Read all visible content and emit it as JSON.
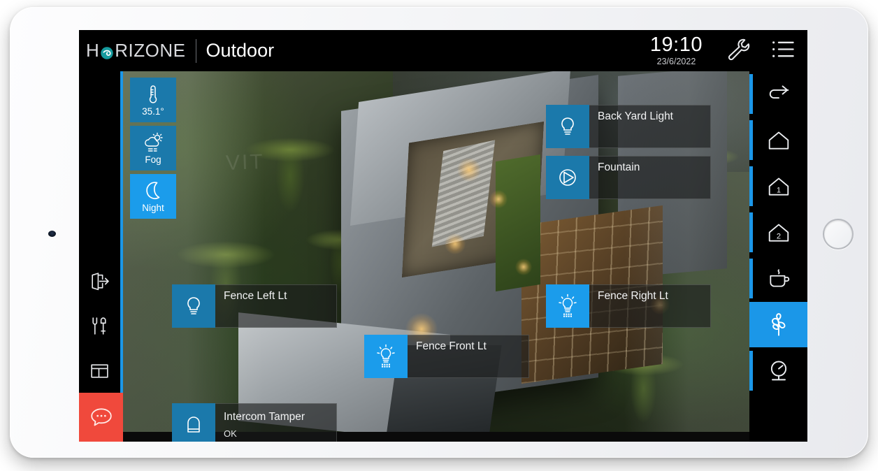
{
  "header": {
    "brand": "HORIZONE",
    "brand_mark_icon": "horizone-swirl-icon",
    "page_title": "Outdoor",
    "time": "19:10",
    "date": "23/6/2022",
    "settings_icon": "wrench-icon",
    "menu_icon": "list-menu-icon"
  },
  "colors": {
    "accent_blue": "#1b9ceb",
    "tile_blue": "#1b79ab",
    "alert_red": "#f0493c",
    "brand_teal": "#169b9e"
  },
  "left_rail": {
    "items": [
      {
        "name": "logout-button",
        "icon": "exit-door-arrow-icon"
      },
      {
        "name": "tools-button",
        "icon": "wrench-screwdriver-icon"
      },
      {
        "name": "layout-button",
        "icon": "panels-layout-icon"
      }
    ],
    "chat": {
      "name": "messages-button",
      "icon": "chat-bubble-dots-icon"
    }
  },
  "right_nav": {
    "items": [
      {
        "label": "Back",
        "icon": "back-arrow-icon",
        "active": false
      },
      {
        "label": "Ground Floor",
        "icon": "house-icon",
        "active": false
      },
      {
        "label": "Floor 1",
        "icon": "house-1-icon",
        "active": false,
        "badge": "1"
      },
      {
        "label": "Floor 2",
        "icon": "house-2-icon",
        "active": false,
        "badge": "2"
      },
      {
        "label": "Kitchen",
        "icon": "coffee-cup-icon",
        "active": false
      },
      {
        "label": "Outdoor",
        "icon": "plant-garden-icon",
        "active": true
      },
      {
        "label": "Meters",
        "icon": "gauge-meter-icon",
        "active": false
      }
    ]
  },
  "widgets": [
    {
      "name": "temperature-widget",
      "icon": "thermometer-icon",
      "value": "35.1°",
      "state": "normal"
    },
    {
      "name": "weather-widget",
      "icon": "cloud-sun-fog-icon",
      "value": "Fog",
      "state": "normal"
    },
    {
      "name": "daynight-widget",
      "icon": "moon-icon",
      "value": "Night",
      "state": "active"
    }
  ],
  "devices": [
    {
      "name": "back-yard-light",
      "title": "Back Yard Light",
      "icon": "light-bulb-off-icon",
      "on": false,
      "status": ""
    },
    {
      "name": "fountain",
      "title": "Fountain",
      "icon": "pump-circle-icon",
      "on": false,
      "status": ""
    },
    {
      "name": "fence-left-light",
      "title": "Fence Left Lt",
      "icon": "light-bulb-off-icon",
      "on": false,
      "status": ""
    },
    {
      "name": "fence-right-light",
      "title": "Fence Right Lt",
      "icon": "light-bulb-on-icon",
      "on": true,
      "status": ""
    },
    {
      "name": "fence-front-light",
      "title": "Fence Front Lt",
      "icon": "light-bulb-on-icon",
      "on": true,
      "status": ""
    },
    {
      "name": "intercom-tamper",
      "title": "Intercom Tamper",
      "icon": "tamper-sensor-icon",
      "on": false,
      "status": "OK"
    }
  ],
  "scene": {
    "watermark": "VIT",
    "description": "Aerial dusk view of a modern villa with rooftop terrace, lawn and palm trees"
  }
}
